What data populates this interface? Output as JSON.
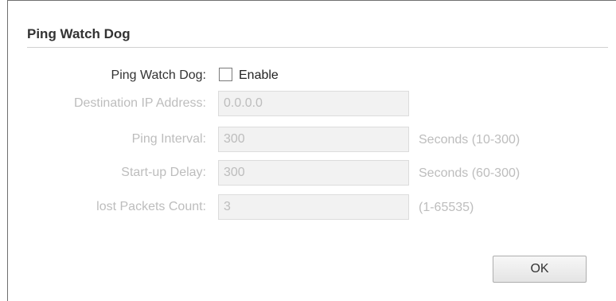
{
  "section": {
    "title": "Ping Watch Dog"
  },
  "form": {
    "watchdog": {
      "label": "Ping Watch Dog:",
      "checkbox_label": "Enable",
      "checked": false
    },
    "destination_ip": {
      "label": "Destination IP Address:",
      "value": "0.0.0.0"
    },
    "ping_interval": {
      "label": "Ping Interval:",
      "value": "300",
      "hint": "Seconds (10-300)"
    },
    "startup_delay": {
      "label": "Start-up Delay:",
      "value": "300",
      "hint": "Seconds (60-300)"
    },
    "lost_packets": {
      "label": "lost Packets Count:",
      "value": "3",
      "hint": "(1-65535)"
    }
  },
  "actions": {
    "ok_label": "OK"
  }
}
